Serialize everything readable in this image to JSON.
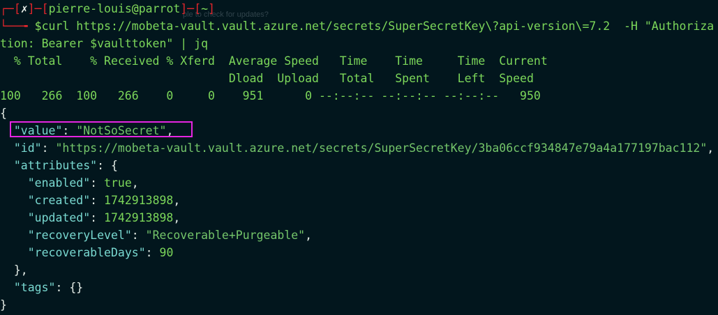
{
  "prompt": {
    "open_bracket": "┌─[",
    "status_icon": "✗",
    "separator": "]─[",
    "user": "pierre-louis",
    "at": "@",
    "host": "parrot",
    "separator2": "]─[",
    "cwd": "~",
    "close_bracket": "]",
    "corner": "└──╼ ",
    "dollar": "$",
    "command_line1": "curl https://mobeta-vault.vault.azure.net/secrets/SuperSecretKey\\?api-version\\=7.2  -H \"Authoriza",
    "command_line2": "tion: Bearer $vaulttoken\" | jq"
  },
  "ghost_notification": "ple to check for updates?",
  "curl_progress": {
    "header1": "  % Total    % Received % Xferd  Average Speed   Time    Time     Time  Current",
    "header2": "                                 Dload  Upload   Total   Spent    Left  Speed",
    "values": "100   266  100   266    0     0    951      0 --:--:-- --:--:-- --:--:--   950"
  },
  "json_output": {
    "open_brace": "{",
    "value_key": "\"value\"",
    "value_val": "\"NotSoSecret\"",
    "id_key": "\"id\"",
    "id_val": "\"https://mobeta-vault.vault.azure.net/secrets/SuperSecretKey/3ba06ccf934847e79a4a177197bac112\"",
    "attributes_key": "\"attributes\"",
    "enabled_key": "\"enabled\"",
    "enabled_val": "true",
    "created_key": "\"created\"",
    "created_val": "1742913898",
    "updated_key": "\"updated\"",
    "updated_val": "1742913898",
    "recovery_key": "\"recoveryLevel\"",
    "recovery_val": "\"Recoverable+Purgeable\"",
    "recoverable_days_key": "\"recoverableDays\"",
    "recoverable_days_val": "90",
    "attributes_close": "},",
    "tags_key": "\"tags\"",
    "tags_val": "{}",
    "close_brace": "}"
  },
  "colors": {
    "background": "#02161d",
    "prompt_red": "#e2262c",
    "prompt_green": "#7cd75a",
    "json_key": "#79d8d0",
    "json_string": "#74c56a",
    "highlight_box": "#e625e2"
  }
}
